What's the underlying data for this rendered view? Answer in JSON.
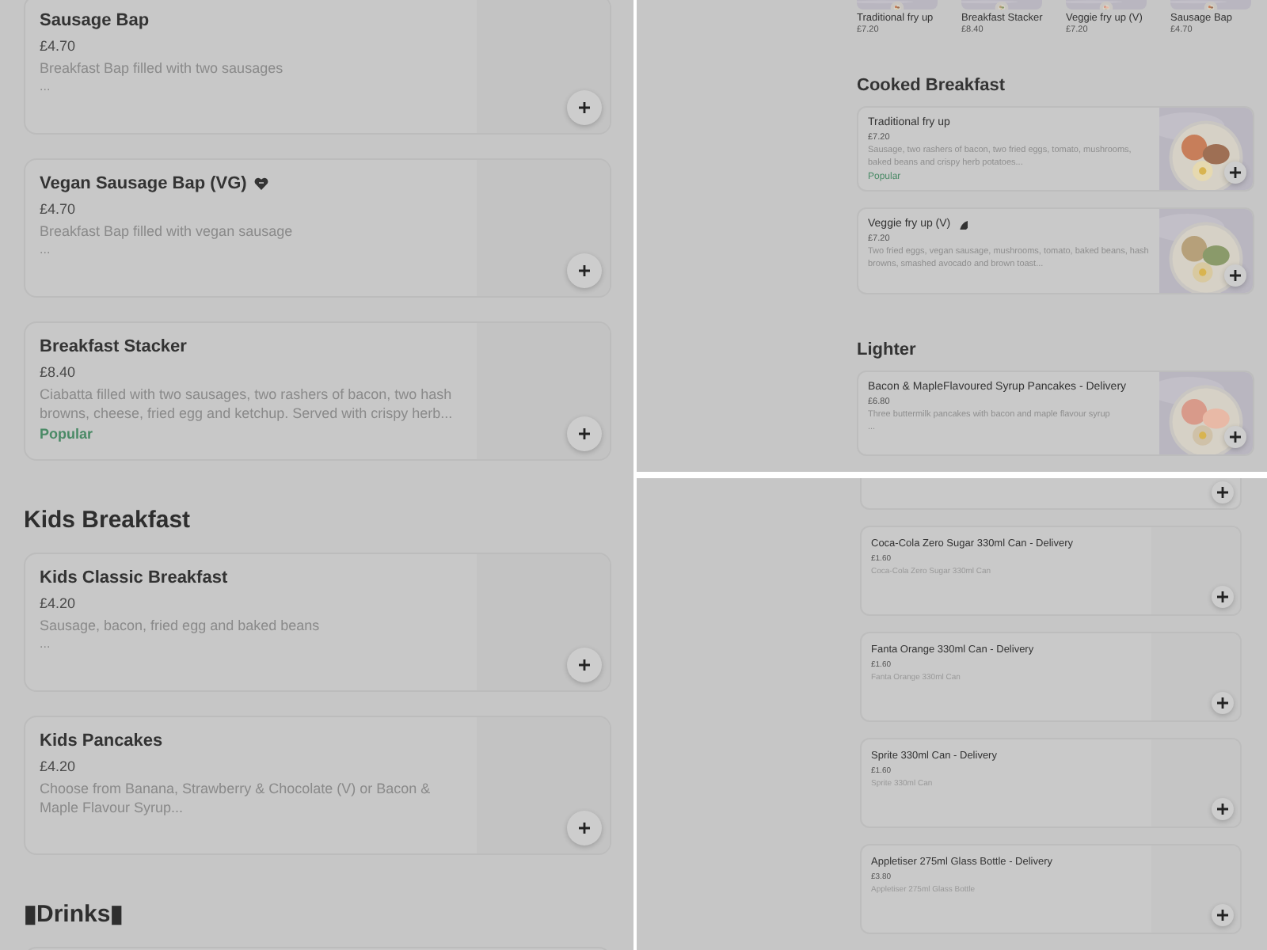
{
  "left_view": {
    "sections": [
      {
        "items": [
          {
            "name": "Sausage Bap",
            "vegan": false,
            "price": "£4.70",
            "description": "Breakfast Bap filled with two sausages",
            "ellipsis": "..."
          },
          {
            "name": "Vegan Sausage Bap (VG)",
            "vegan": true,
            "price": "£4.70",
            "description": "Breakfast Bap filled with vegan sausage",
            "ellipsis": "..."
          },
          {
            "name": "Breakfast Stacker",
            "vegan": false,
            "price": "£8.40",
            "description": "Ciabatta filled with two sausages, two rashers of bacon, two hash browns, cheese, fried egg and ketchup. Served with crispy herb...",
            "badge": "Popular"
          }
        ]
      },
      {
        "heading": "Kids Breakfast",
        "items": [
          {
            "name": "Kids Classic Breakfast",
            "vegan": false,
            "price": "£4.20",
            "description": "Sausage, bacon, fried egg and baked beans",
            "ellipsis": "..."
          },
          {
            "name": "Kids Pancakes",
            "vegan": false,
            "price": "£4.20",
            "description": "Choose from Banana, Strawberry & Chocolate (V) or Bacon & Maple Flavour Syrup..."
          }
        ]
      },
      {
        "heading": "▮Drinks▮"
      }
    ]
  },
  "top_right_view": {
    "popular_carousel": [
      {
        "name": "Traditional fry up",
        "price": "£7.20"
      },
      {
        "name": "Breakfast Stacker",
        "price": "£8.40"
      },
      {
        "name": "Veggie fry up (V)",
        "price": "£7.20"
      },
      {
        "name": "Sausage Bap",
        "price": "£4.70"
      }
    ],
    "sections": [
      {
        "heading": "Cooked Breakfast",
        "items": [
          {
            "name": "Traditional fry up",
            "vegetarian": false,
            "price": "£7.20",
            "description": "Sausage, two rashers of bacon, two fried eggs, tomato, mushrooms, baked beans and crispy herb potatoes...",
            "badge": "Popular"
          },
          {
            "name": "Veggie fry up (V)",
            "vegetarian": true,
            "price": "£7.20",
            "description": "Two fried eggs, vegan sausage, mushrooms, tomato, baked beans, hash browns, smashed avocado and brown toast..."
          }
        ]
      },
      {
        "heading": "Lighter",
        "items": [
          {
            "name": "Bacon & MapleFlavoured Syrup Pancakes - Delivery",
            "vegetarian": false,
            "price": "£6.80",
            "description": "Three buttermilk pancakes with bacon and maple flavour syrup",
            "ellipsis": "..."
          }
        ]
      }
    ]
  },
  "bottom_right_view": {
    "items": [
      {
        "kind": "partial"
      },
      {
        "kind": "item",
        "name": "Coca-Cola Zero Sugar 330ml Can - Delivery",
        "price": "£1.60",
        "description": "Coca-Cola Zero Sugar 330ml Can"
      },
      {
        "kind": "item",
        "name": "Fanta Orange 330ml Can - Delivery",
        "price": "£1.60",
        "description": "Fanta Orange 330ml Can"
      },
      {
        "kind": "item",
        "name": "Sprite 330ml Can - Delivery",
        "price": "£1.60",
        "description": "Sprite 330ml Can"
      },
      {
        "kind": "item",
        "name": "Appletiser 275ml Glass Bottle - Delivery",
        "price": "£3.80",
        "description": "Appletiser 275ml Glass Bottle"
      }
    ]
  }
}
